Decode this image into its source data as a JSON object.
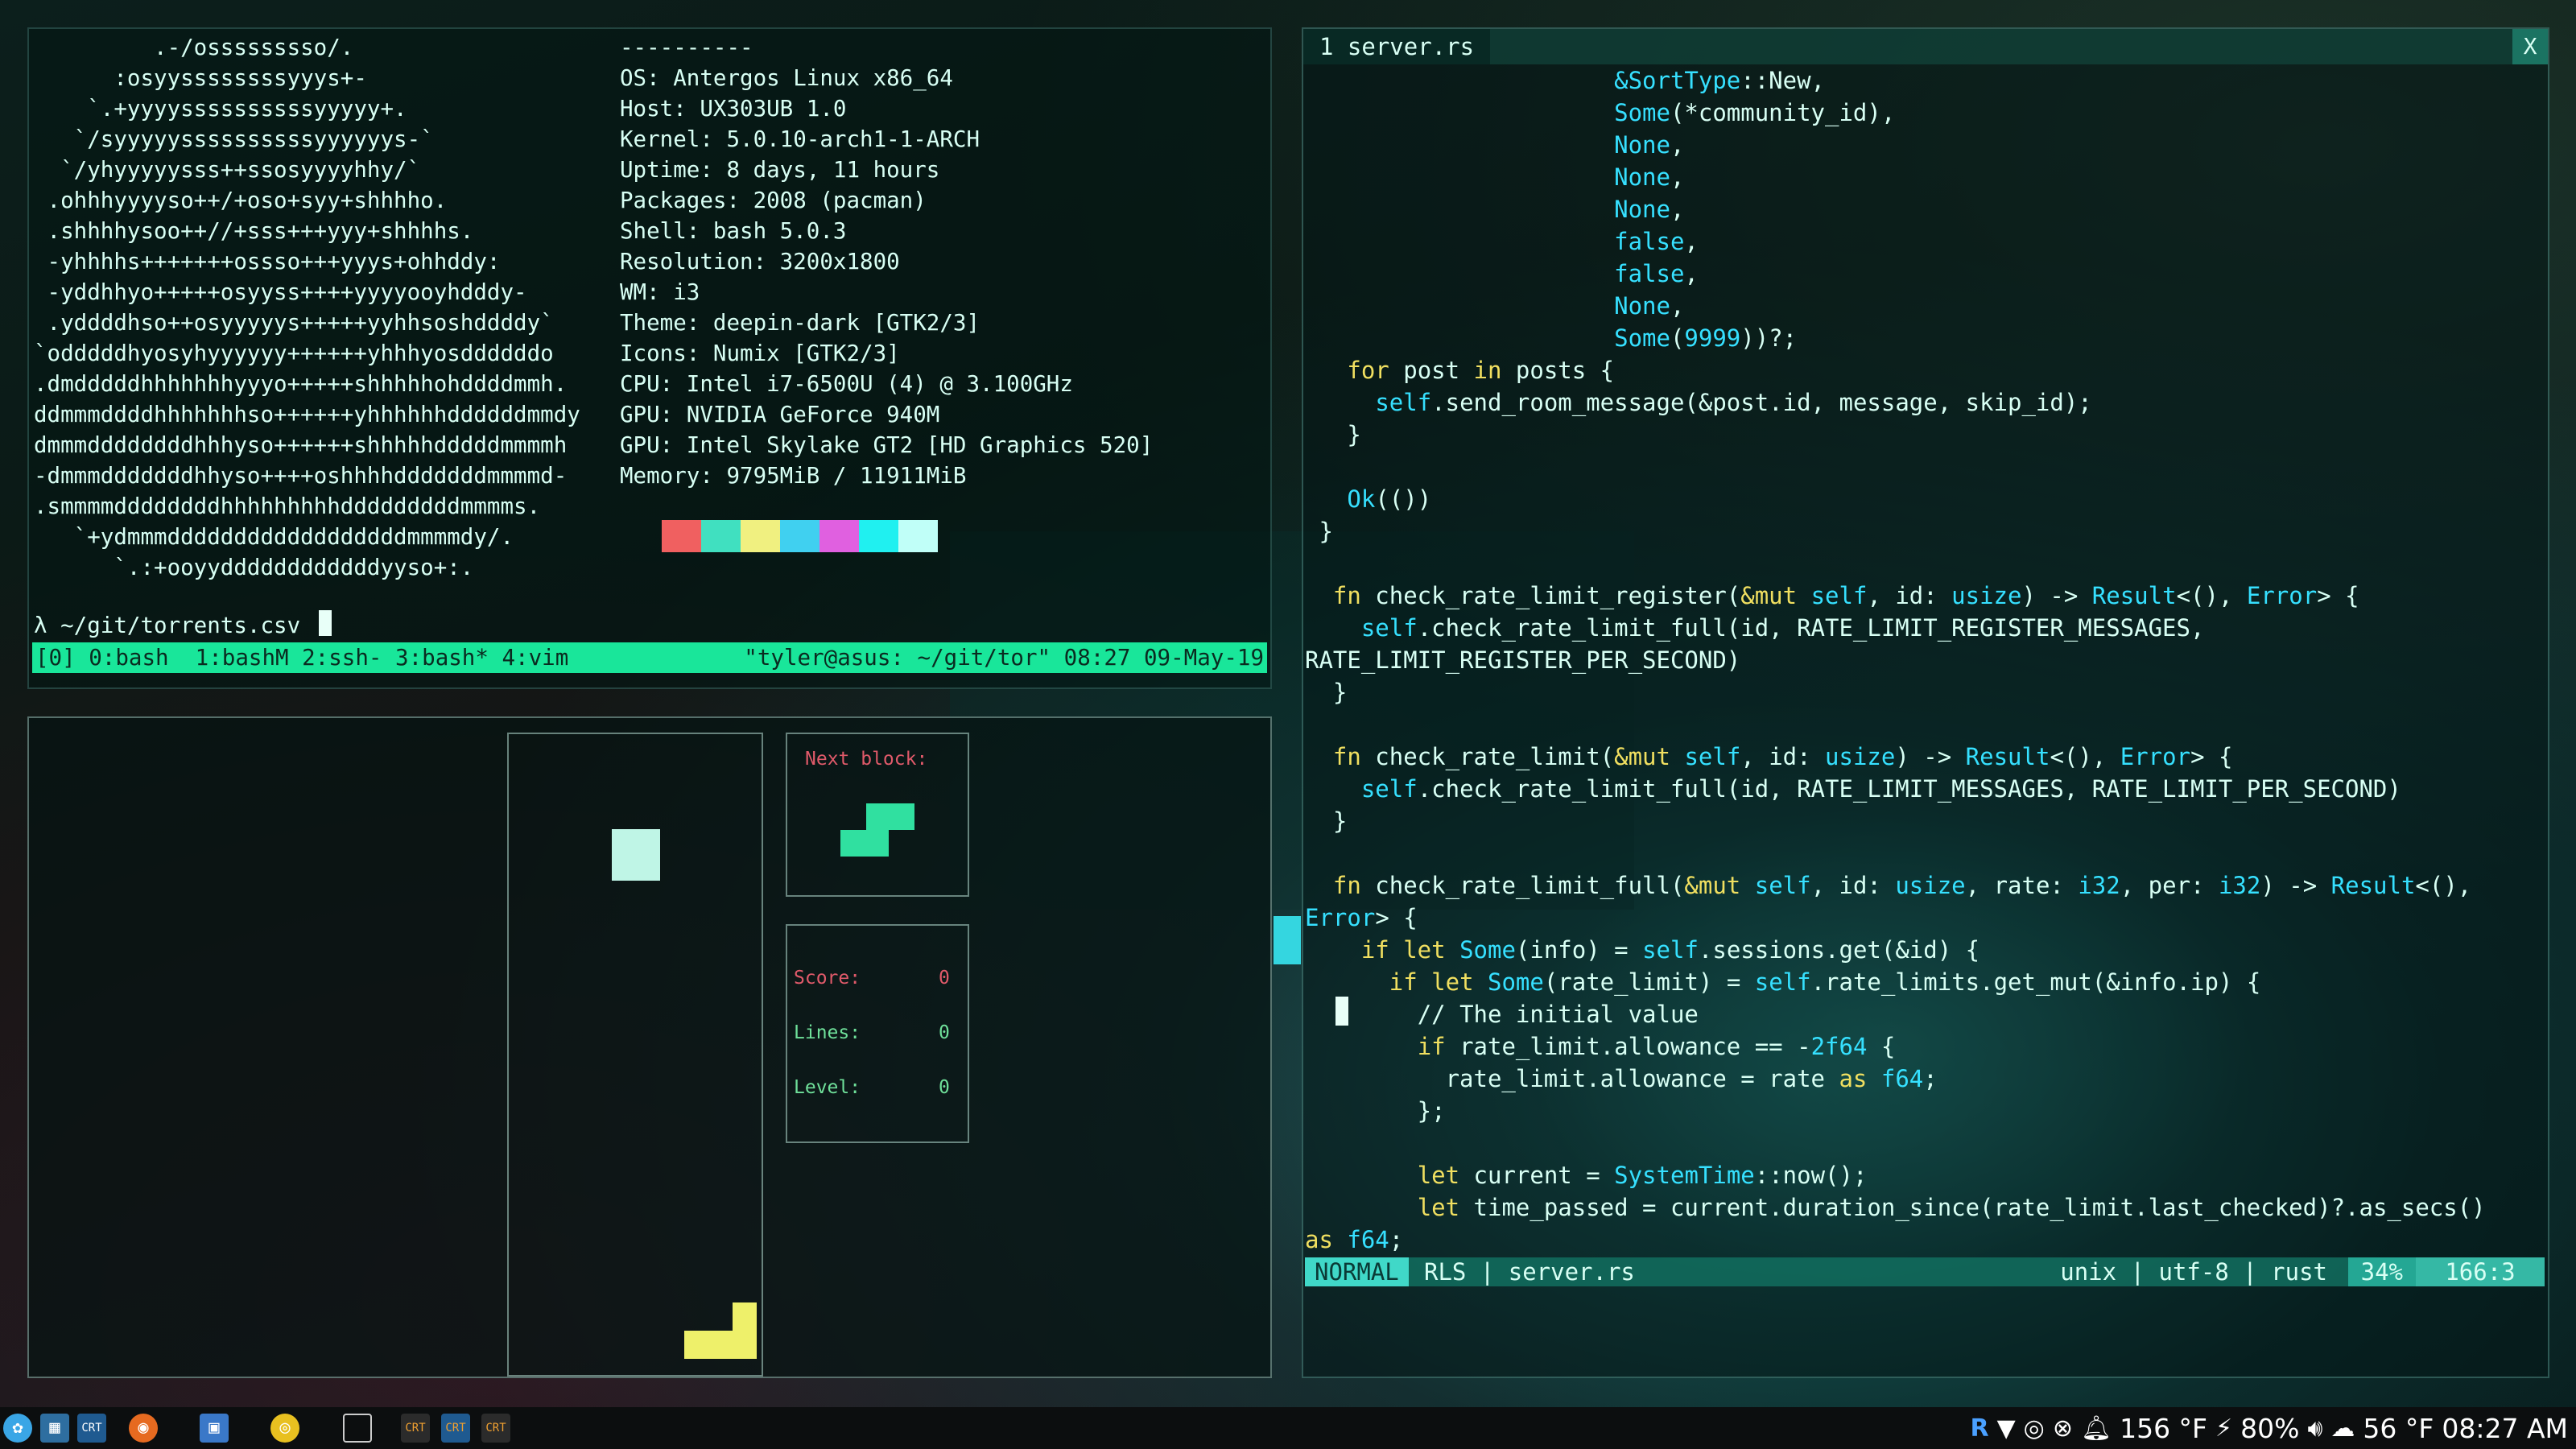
{
  "neofetch": {
    "ascii_lines": [
      "         .-/osssssssso/.",
      "      :osyyssssssssyyys+-",
      "    `.+yyyyssssssssssyyyyy+.",
      "   `/syyyyyssssssssssyyyyyys-`",
      "  `/yhyyyyysss++ssosyyyyhhy/`",
      " .ohhhyyyyso++/+oso+syy+shhhho.",
      " .shhhhysoo++//+sss+++yyy+shhhhs.",
      " -yhhhhs+++++++ossso+++yyys+ohhddy:",
      " -yddhhyo+++++osyyss++++yyyyooyhdddy-",
      " .yddddhso++osyyyyys+++++yyhhsoshddddy`",
      "`odddddhyosyhyyyyyy++++++yhhhyosddddddo",
      ".dmdddddhhhhhhhyyyo+++++shhhhhohddddmmh.",
      "ddmmmddddhhhhhhhso++++++yhhhhhhddddddmmdy",
      "dmmmddddddddhhhyso++++++shhhhhdddddmmmmh",
      "-dmmmdddddddhhyso++++oshhhhdddddddmmmmd-",
      ".smmmmddddddddhhhhhhhhhdddddddddmmmms.",
      "   `+ydmmmddddddddddddddddddmmmmdy/.",
      "      `.:+ooyyddddddddddddyyso+:."
    ],
    "info_lines": [
      "----------",
      "OS: Antergos Linux x86_64",
      "Host: UX303UB 1.0",
      "Kernel: 5.0.10-arch1-1-ARCH",
      "Uptime: 8 days, 11 hours",
      "Packages: 2008 (pacman)",
      "Shell: bash 5.0.3",
      "Resolution: 3200x1800",
      "WM: i3",
      "Theme: deepin-dark [GTK2/3]",
      "Icons: Numix [GTK2/3]",
      "CPU: Intel i7-6500U (4) @ 3.100GHz",
      "GPU: NVIDIA GeForce 940M",
      "GPU: Intel Skylake GT2 [HD Graphics 520]",
      "Memory: 9795MiB / 11911MiB"
    ],
    "swatch_colors": [
      "#f06060",
      "#40e0c0",
      "#f0f080",
      "#40d0f0",
      "#e060e0",
      "#20f0f0",
      "#c0fff8"
    ],
    "prompt": "λ ~/git/torrents.csv ",
    "tmux_left": "[0] 0:bash  1:bashM 2:ssh- 3:bash* 4:vim",
    "tmux_right": "\"tyler@asus: ~/git/tor\" 08:27 09-May-19"
  },
  "tetris": {
    "next_label": "Next block:",
    "score_label": "Score:",
    "score_value": "0",
    "lines_label": "Lines:",
    "lines_value": "0",
    "level_label": "Level:",
    "level_value": "0",
    "piece_color": "#bff5e6",
    "next_color": "#30e0a0",
    "bottom_color": "#eef06a"
  },
  "editor": {
    "tab_label": "1 server.rs",
    "close_label": "X",
    "mode": "NORMAL",
    "status_left": "RLS | server.rs",
    "status_right": "unix | utf-8 | rust",
    "percent": "34%",
    "position": "166:3"
  },
  "taskbar": {
    "temp_cpu": "156 °F",
    "battery": "80%",
    "weather": "56 °F",
    "clock": "08:27 AM"
  }
}
